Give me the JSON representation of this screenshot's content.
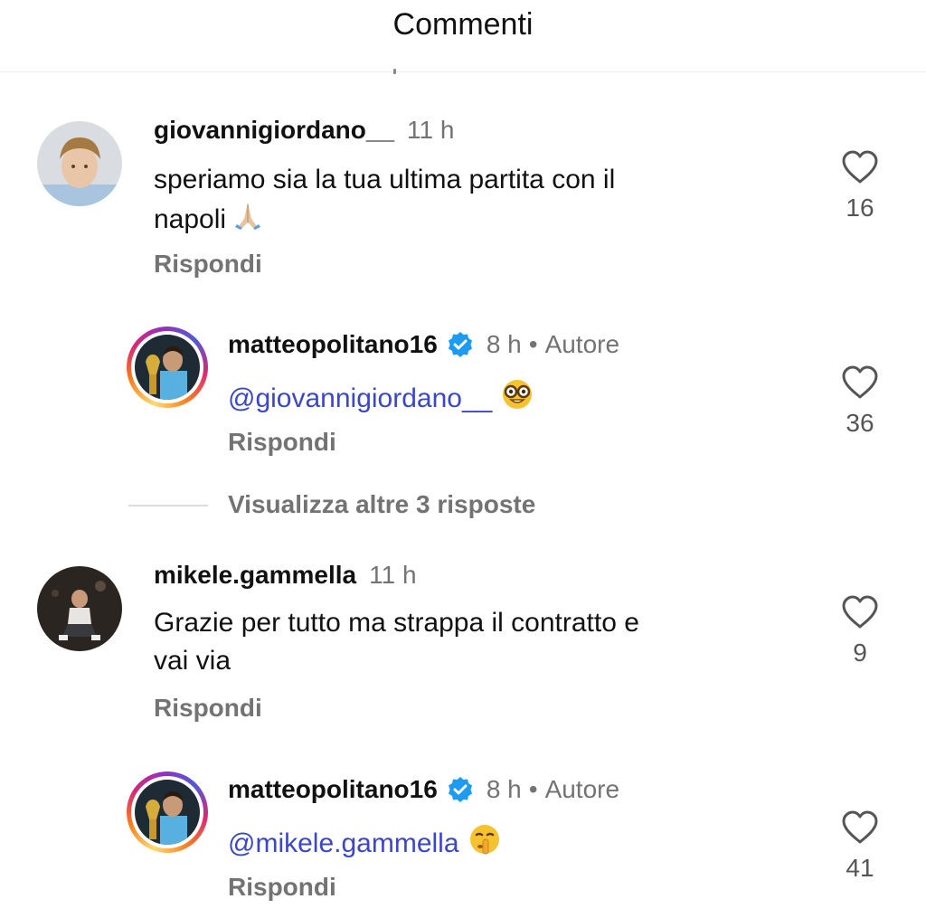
{
  "header": {
    "title": "Commenti"
  },
  "comments": [
    {
      "username": "giovannigiordano__",
      "time": "11 h",
      "text": "speriamo sia la tua ultima partita con il napoli",
      "text_line1": "speriamo sia la tua ultima partita con il",
      "text_line2": "napoli",
      "emoji": "🙏🏼",
      "reply_label": "Rispondi",
      "likes": "16",
      "icon": "heart-outline-icon"
    },
    {
      "username": "matteopolitano16",
      "verified": true,
      "time": "8 h",
      "separator": "•",
      "author_label": "Autore",
      "mention": "@giovannigiordano__",
      "emoji": "🤓",
      "reply_label": "Rispondi",
      "likes": "36",
      "icon": "heart-outline-icon"
    },
    {
      "view_more": "Visualizza altre 3 risposte"
    },
    {
      "username": "mikele.gammella",
      "time": "11 h",
      "text": "Grazie per tutto ma strappa il contratto e vai via",
      "text_line1": "Grazie per tutto ma strappa il contratto e",
      "text_line2": "vai via",
      "reply_label": "Rispondi",
      "likes": "9",
      "icon": "heart-outline-icon"
    },
    {
      "username": "matteopolitano16",
      "verified": true,
      "time": "8 h",
      "separator": "•",
      "author_label": "Autore",
      "mention": "@mikele.gammella",
      "emoji": "🤫",
      "reply_label": "Rispondi",
      "likes": "41",
      "icon": "heart-outline-icon"
    }
  ],
  "colors": {
    "mention": "#3b47c6",
    "verified": "#1d9bf0",
    "secondary_text": "#737373"
  }
}
